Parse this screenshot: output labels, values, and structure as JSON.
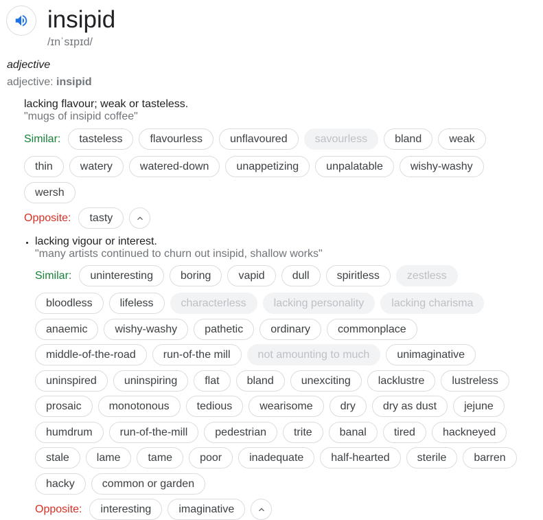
{
  "entry": {
    "word": "insipid",
    "phonetic": "/ɪnˈsɪpɪd/",
    "part_of_speech": "adjective",
    "forms_prefix": "adjective: ",
    "forms_word": "insipid"
  },
  "labels": {
    "similar": "Similar:",
    "opposite": "Opposite:"
  },
  "icons": {
    "speaker": "speaker-icon",
    "collapse": "chevron-up-icon"
  },
  "colors": {
    "similar": "#188038",
    "opposite": "#d93025",
    "speaker": "#1a73e8"
  },
  "senses": [
    {
      "definition": "lacking flavour; weak or tasteless.",
      "example": "\"mugs of insipid coffee\"",
      "similar_rows": [
        [
          {
            "t": "tasteless",
            "d": false
          },
          {
            "t": "flavourless",
            "d": false
          },
          {
            "t": "unflavoured",
            "d": false
          },
          {
            "t": "savourless",
            "d": true
          },
          {
            "t": "bland",
            "d": false
          },
          {
            "t": "weak",
            "d": false
          }
        ],
        [
          {
            "t": "thin",
            "d": false
          },
          {
            "t": "watery",
            "d": false
          },
          {
            "t": "watered-down",
            "d": false
          },
          {
            "t": "unappetizing",
            "d": false
          },
          {
            "t": "unpalatable",
            "d": false
          },
          {
            "t": "wishy-washy",
            "d": false
          }
        ],
        [
          {
            "t": "wersh",
            "d": false
          }
        ]
      ],
      "opposite": [
        {
          "t": "tasty",
          "d": false
        }
      ]
    },
    {
      "definition": "lacking vigour or interest.",
      "example": "\"many artists continued to churn out insipid, shallow works\"",
      "similar_rows": [
        [
          {
            "t": "uninteresting",
            "d": false
          },
          {
            "t": "boring",
            "d": false
          },
          {
            "t": "vapid",
            "d": false
          },
          {
            "t": "dull",
            "d": false
          },
          {
            "t": "spiritless",
            "d": false
          },
          {
            "t": "zestless",
            "d": true
          }
        ],
        [
          {
            "t": "bloodless",
            "d": false
          },
          {
            "t": "lifeless",
            "d": false
          },
          {
            "t": "characterless",
            "d": true
          },
          {
            "t": "lacking personality",
            "d": true
          },
          {
            "t": "lacking charisma",
            "d": true
          }
        ],
        [
          {
            "t": "anaemic",
            "d": false
          },
          {
            "t": "wishy-washy",
            "d": false
          },
          {
            "t": "pathetic",
            "d": false
          },
          {
            "t": "ordinary",
            "d": false
          },
          {
            "t": "commonplace",
            "d": false
          }
        ],
        [
          {
            "t": "middle-of-the-road",
            "d": false
          },
          {
            "t": "run-of-the mill",
            "d": false
          },
          {
            "t": "not amounting to much",
            "d": true
          },
          {
            "t": "unimaginative",
            "d": false
          }
        ],
        [
          {
            "t": "uninspired",
            "d": false
          },
          {
            "t": "uninspiring",
            "d": false
          },
          {
            "t": "flat",
            "d": false
          },
          {
            "t": "bland",
            "d": false
          },
          {
            "t": "unexciting",
            "d": false
          },
          {
            "t": "lacklustre",
            "d": false
          },
          {
            "t": "lustreless",
            "d": false
          }
        ],
        [
          {
            "t": "prosaic",
            "d": false
          },
          {
            "t": "monotonous",
            "d": false
          },
          {
            "t": "tedious",
            "d": false
          },
          {
            "t": "wearisome",
            "d": false
          },
          {
            "t": "dry",
            "d": false
          },
          {
            "t": "dry as dust",
            "d": false
          },
          {
            "t": "jejune",
            "d": false
          }
        ],
        [
          {
            "t": "humdrum",
            "d": false
          },
          {
            "t": "run-of-the-mill",
            "d": false
          },
          {
            "t": "pedestrian",
            "d": false
          },
          {
            "t": "trite",
            "d": false
          },
          {
            "t": "banal",
            "d": false
          },
          {
            "t": "tired",
            "d": false
          },
          {
            "t": "hackneyed",
            "d": false
          }
        ],
        [
          {
            "t": "stale",
            "d": false
          },
          {
            "t": "lame",
            "d": false
          },
          {
            "t": "tame",
            "d": false
          },
          {
            "t": "poor",
            "d": false
          },
          {
            "t": "inadequate",
            "d": false
          },
          {
            "t": "half-hearted",
            "d": false
          },
          {
            "t": "sterile",
            "d": false
          },
          {
            "t": "barren",
            "d": false
          }
        ],
        [
          {
            "t": "hacky",
            "d": false
          },
          {
            "t": "common or garden",
            "d": false
          }
        ]
      ],
      "opposite": [
        {
          "t": "interesting",
          "d": false
        },
        {
          "t": "imaginative",
          "d": false
        }
      ]
    }
  ]
}
